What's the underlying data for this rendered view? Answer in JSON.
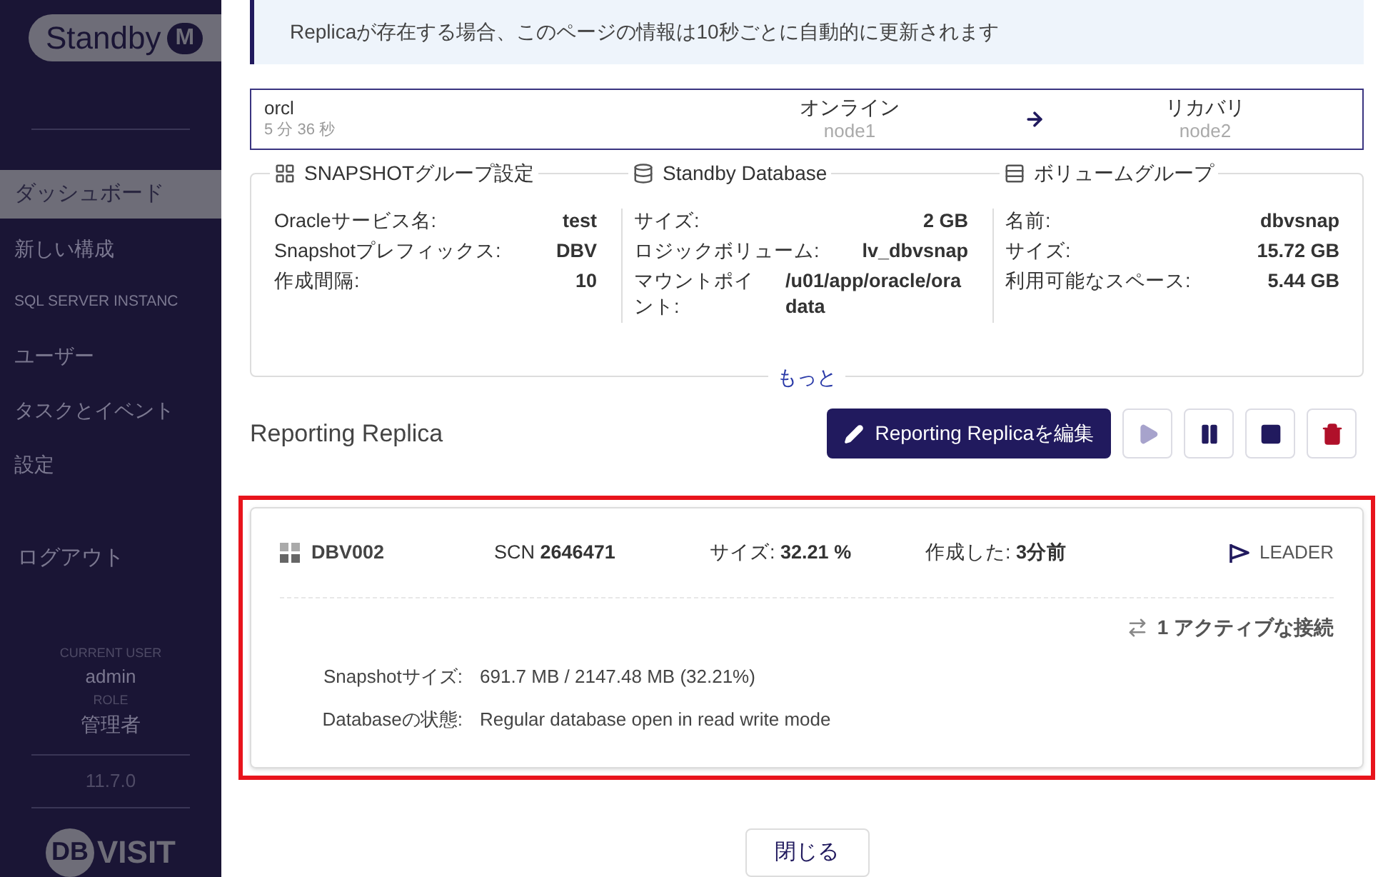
{
  "sidebar": {
    "logo": {
      "text": "Standby",
      "badge": "M"
    },
    "items": [
      {
        "label": "ダッシュボード",
        "selected": true
      },
      {
        "label": "新しい構成",
        "selected": false
      },
      {
        "label": "SQL SERVER INSTANC",
        "selected": false
      },
      {
        "label": "ユーザー",
        "selected": false
      },
      {
        "label": "タスクとイベント",
        "selected": false
      },
      {
        "label": "設定",
        "selected": false
      }
    ],
    "logout": "ログアウト",
    "user": {
      "caption": "CURRENT USER",
      "name": "admin",
      "role_caption": "ROLE",
      "role": "管理者"
    },
    "version": "11.7.0",
    "brand": {
      "mark": "DB",
      "name": "VISIT"
    }
  },
  "banner": "Replicaが存在する場合、このページの情報は10秒ごとに自動的に更新されます",
  "status": {
    "name": "orcl",
    "uptime": "5 分 36 秒",
    "source": {
      "state": "オンライン",
      "node": "node1"
    },
    "target": {
      "state": "リカバリ",
      "node": "node2"
    }
  },
  "panels": [
    {
      "kind": "grid",
      "title": "SNAPSHOTグループ設定",
      "rows": [
        {
          "label": "Oracleサービス名:",
          "value": "test"
        },
        {
          "label": "Snapshotプレフィックス:",
          "value": "DBV"
        },
        {
          "label": "作成間隔:",
          "value": "10"
        }
      ]
    },
    {
      "kind": "database",
      "title": "Standby Database",
      "rows": [
        {
          "label": "サイズ:",
          "value": "2 GB"
        },
        {
          "label": "ロジックボリューム:",
          "value": "lv_dbvsnap"
        },
        {
          "label": "マウントポイント:",
          "value": "/u01/app/oracle/oradata"
        }
      ]
    },
    {
      "kind": "rows",
      "title": "ボリュームグループ",
      "rows": [
        {
          "label": "名前:",
          "value": "dbvsnap"
        },
        {
          "label": "サイズ:",
          "value": "15.72 GB"
        },
        {
          "label": "利用可能なスペース:",
          "value": "5.44 GB"
        }
      ]
    }
  ],
  "more_link": "もっと",
  "replica": {
    "title": "Reporting Replica",
    "buttons": [
      {
        "kind": "edit",
        "label": "Reporting Replicaを編集",
        "disabled": false
      },
      {
        "kind": "play",
        "disabled": true
      },
      {
        "kind": "pause",
        "disabled": false
      },
      {
        "kind": "stop",
        "disabled": false
      },
      {
        "kind": "delete",
        "disabled": false
      }
    ],
    "card": {
      "highlighted": true,
      "name": "DBV002",
      "scn_label": "SCN",
      "scn": "2646471",
      "size_label": "サイズ:",
      "size": "32.21 %",
      "created_label": "作成した:",
      "created": "3分前",
      "role": "LEADER",
      "connections": "1 アクティブな接続",
      "details": [
        {
          "label": "Snapshotサイズ:",
          "value": "691.7 MB / 2147.48 MB (32.21%)"
        },
        {
          "label": "Databaseの状態:",
          "value": "Regular database open in read write mode"
        }
      ]
    }
  },
  "close_button": "閉じる"
}
